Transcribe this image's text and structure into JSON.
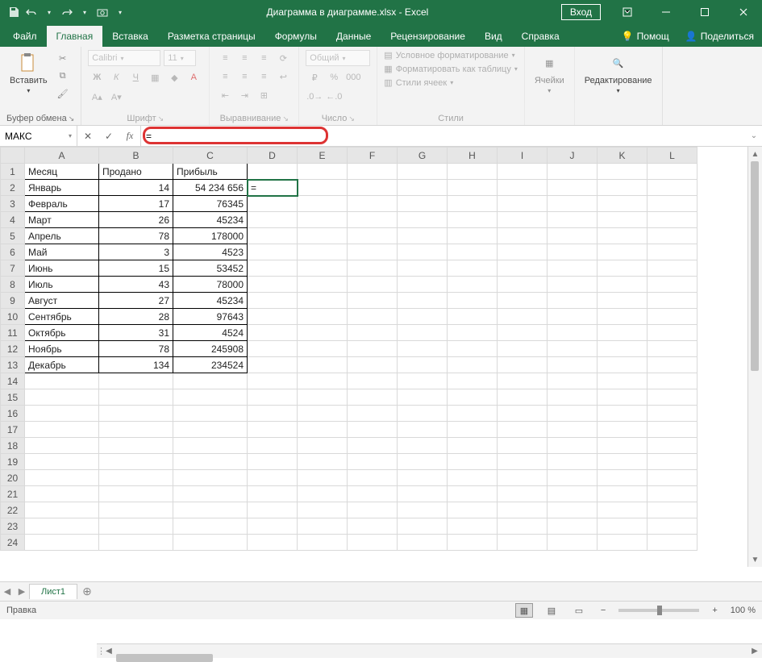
{
  "titlebar": {
    "doc_title": "Диаграмма в диаграмме.xlsx  -  Excel",
    "signin": "Вход"
  },
  "tabs": {
    "file": "Файл",
    "home": "Главная",
    "insert": "Вставка",
    "page_layout": "Разметка страницы",
    "formulas": "Формулы",
    "data": "Данные",
    "review": "Рецензирование",
    "view": "Вид",
    "help": "Справка",
    "tellme": "Помощ",
    "share": "Поделиться"
  },
  "ribbon": {
    "clipboard": {
      "paste": "Вставить",
      "group": "Буфер обмена"
    },
    "font": {
      "name": "Calibri",
      "size": "11",
      "group": "Шрифт"
    },
    "align": {
      "group": "Выравнивание"
    },
    "number": {
      "format": "Общий",
      "group": "Число"
    },
    "styles": {
      "cond": "Условное форматирование",
      "table": "Форматировать как таблицу",
      "cell": "Стили ячеек",
      "group": "Стили"
    },
    "cells": {
      "label": "Ячейки"
    },
    "editing": {
      "label": "Редактирование"
    }
  },
  "formula": {
    "namebox": "МАКС",
    "value": "="
  },
  "sheet": {
    "columns": [
      "A",
      "B",
      "C",
      "D",
      "E",
      "F",
      "G",
      "H",
      "I",
      "J",
      "K",
      "L"
    ],
    "headers": {
      "A": "Месяц",
      "B": "Продано",
      "C": "Прибыль"
    },
    "rows": [
      {
        "n": 1
      },
      {
        "n": 2,
        "A": "Январь",
        "B": "14",
        "C": "54 234 656",
        "D": "="
      },
      {
        "n": 3,
        "A": "Февраль",
        "B": "17",
        "C": "76345"
      },
      {
        "n": 4,
        "A": "Март",
        "B": "26",
        "C": "45234"
      },
      {
        "n": 5,
        "A": "Апрель",
        "B": "78",
        "C": "178000"
      },
      {
        "n": 6,
        "A": "Май",
        "B": "3",
        "C": "4523"
      },
      {
        "n": 7,
        "A": "Июнь",
        "B": "15",
        "C": "53452"
      },
      {
        "n": 8,
        "A": "Июль",
        "B": "43",
        "C": "78000"
      },
      {
        "n": 9,
        "A": "Август",
        "B": "27",
        "C": "45234"
      },
      {
        "n": 10,
        "A": "Сентябрь",
        "B": "28",
        "C": "97643"
      },
      {
        "n": 11,
        "A": "Октябрь",
        "B": "31",
        "C": "4524"
      },
      {
        "n": 12,
        "A": "Ноябрь",
        "B": "78",
        "C": "245908"
      },
      {
        "n": 13,
        "A": "Декабрь",
        "B": "134",
        "C": "234524"
      },
      {
        "n": 14
      },
      {
        "n": 15
      },
      {
        "n": 16
      },
      {
        "n": 17
      },
      {
        "n": 18
      },
      {
        "n": 19
      },
      {
        "n": 20
      },
      {
        "n": 21
      },
      {
        "n": 22
      },
      {
        "n": 23
      },
      {
        "n": 24
      }
    ],
    "active_cell": "D2",
    "tab_name": "Лист1"
  },
  "status": {
    "mode": "Правка",
    "zoom": "100 %"
  }
}
